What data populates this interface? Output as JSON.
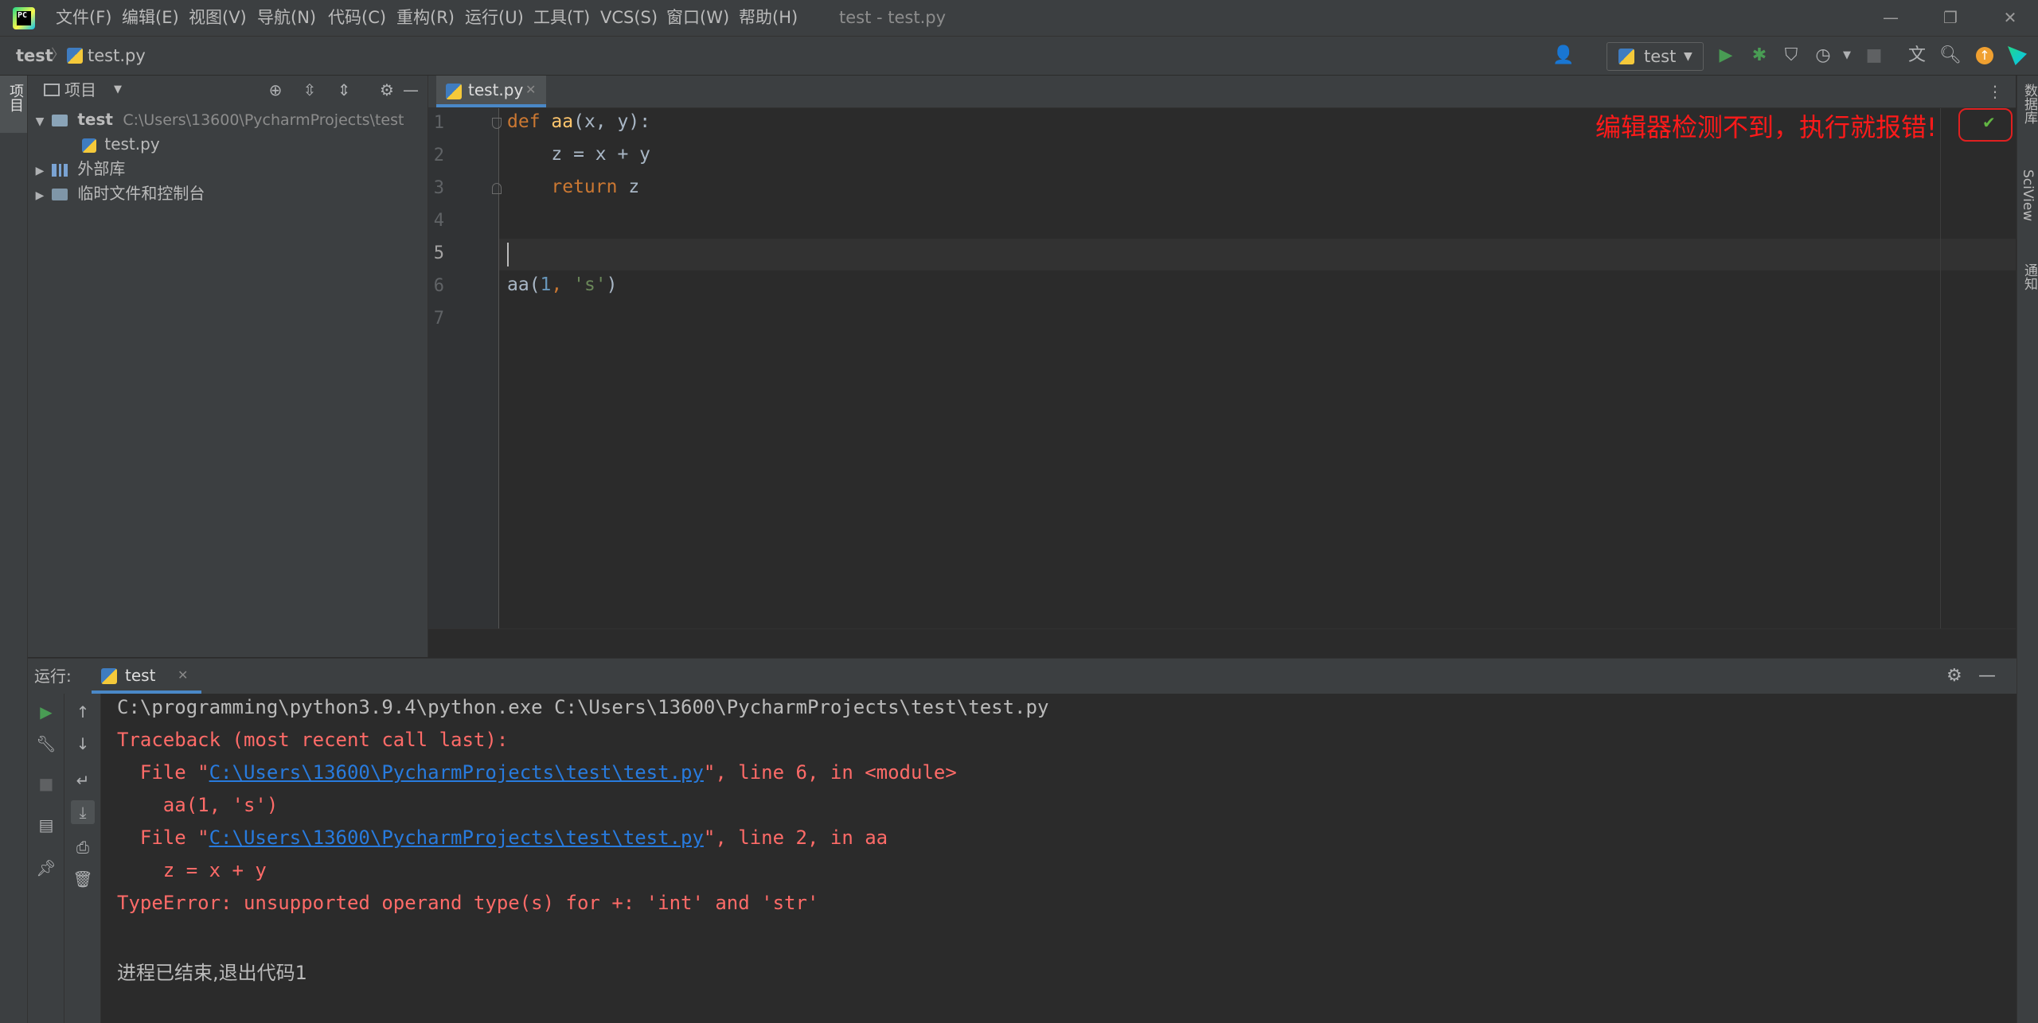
{
  "title_bar": {
    "menu": [
      "文件(F)",
      "编辑(E)",
      "视图(V)",
      "导航(N)",
      "代码(C)",
      "重构(R)",
      "运行(U)",
      "工具(T)",
      "VCS(S)",
      "窗口(W)",
      "帮助(H)"
    ],
    "window_title": "test - test.py",
    "logo_text": "PC"
  },
  "nav_bar": {
    "project": "test",
    "file": "test.py",
    "run_config": "test"
  },
  "left_strip": {
    "project_tab": "项目"
  },
  "project_panel": {
    "title": "项目",
    "tree": {
      "root_name": "test",
      "root_path": "C:\\Users\\13600\\PycharmProjects\\test",
      "file": "test.py",
      "external_libs": "外部库",
      "scratches": "临时文件和控制台"
    }
  },
  "editor": {
    "tab": "test.py",
    "line_numbers": [
      "1",
      "2",
      "3",
      "4",
      "5",
      "6",
      "7"
    ],
    "code": {
      "l1_kw": "def",
      "l1_fn": "aa",
      "l1_rest": "(x, y):",
      "l2": "    z = x + y",
      "l3_indent": "    ",
      "l3_kw": "return",
      "l3_rest": " z",
      "l6_call": "aa(",
      "l6_num": "1",
      "l6_sep": ", ",
      "l6_str": "'s'",
      "l6_end": ")"
    },
    "annotation": "编辑器检测不到，执行就报错!"
  },
  "right_strip": {
    "database": "数据库",
    "sciview": "SciView",
    "notifications": "通知"
  },
  "run_panel": {
    "label": "运行:",
    "tab": "test",
    "console": {
      "cmd": "C:\\programming\\python3.9.4\\python.exe C:\\Users\\13600\\PycharmProjects\\test\\test.py",
      "traceback": "Traceback (most recent call last):",
      "file1_prefix": "  File \"",
      "file1_link": "C:\\Users\\13600\\PycharmProjects\\test\\test.py",
      "file1_suffix": "\", line 6, in <module>",
      "code1": "    aa(1, 's')",
      "file2_prefix": "  File \"",
      "file2_link": "C:\\Users\\13600\\PycharmProjects\\test\\test.py",
      "file2_suffix": "\", line 2, in aa",
      "code2": "    z = x + y",
      "error": "TypeError: unsupported operand type(s) for +: 'int' and 'str'",
      "exit": "进程已结束,退出代码1"
    }
  }
}
